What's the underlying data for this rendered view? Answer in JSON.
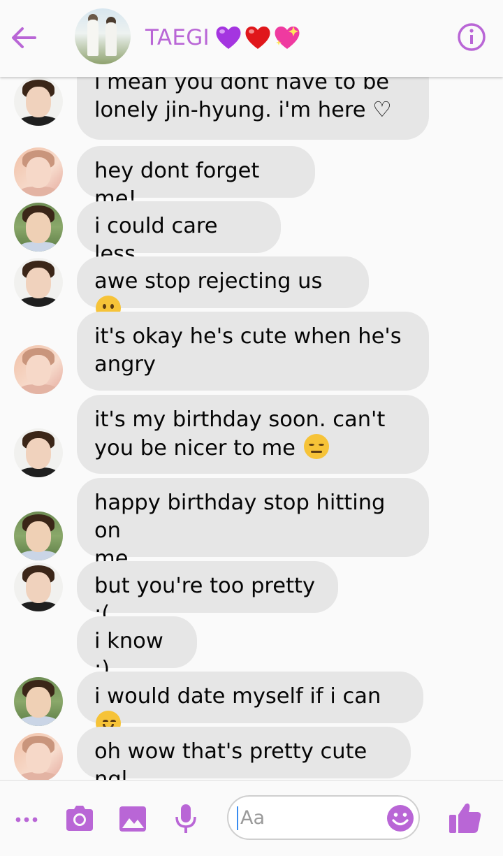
{
  "header": {
    "back_icon": "arrow-left-icon",
    "title": "TAEGI",
    "title_emojis": [
      "purple-heart",
      "red-heart",
      "sparkling-heart"
    ],
    "info_icon": "info-icon",
    "accent_color": "#b966d6"
  },
  "messages": [
    {
      "sender": "jin",
      "text": "i mean you dont have to be\nlonely jin-hyung. i'm here ♡"
    },
    {
      "sender": "rm",
      "text": "hey dont forget me!"
    },
    {
      "sender": "v",
      "text": "i could care less"
    },
    {
      "sender": "jin",
      "text": "awe stop rejecting us ",
      "emoji": "frowning-face"
    },
    {
      "sender": "rm",
      "text": "it's okay he's cute when he's\nangry"
    },
    {
      "sender": "jin",
      "text": "it's my birthday soon. can't\nyou be nicer to me ",
      "emoji": "pensive-face"
    },
    {
      "sender": "v",
      "text": "happy birthday stop hitting on\nme"
    },
    {
      "sender": "jin",
      "text": "but you're too pretty :("
    },
    {
      "sender": "v",
      "text": "i know :)"
    },
    {
      "sender": "v",
      "text": "i would date myself if i can ",
      "emoji": "smiling-face"
    },
    {
      "sender": "rm",
      "text": "oh wow that's pretty cute ngl"
    }
  ],
  "composer": {
    "placeholder": "Aa",
    "tools": [
      "more-icon",
      "camera-icon",
      "image-icon",
      "microphone-icon"
    ],
    "emoji_icon": "emoji-icon",
    "send_icon": "thumbs-up-icon"
  }
}
